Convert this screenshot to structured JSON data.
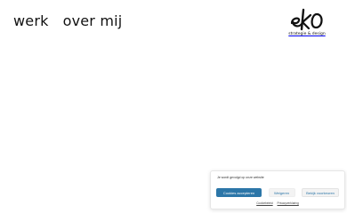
{
  "nav": {
    "items": [
      {
        "label": "werk"
      },
      {
        "label": "over mij"
      }
    ]
  },
  "logo": {
    "tagline": "strategie & design"
  },
  "cookie_banner": {
    "message": "Je wordt gevolgd op onze website",
    "buttons": {
      "accept": "Cookies accepteren",
      "deny": "Weigeren",
      "preferences": "Bekijk voorkeuren"
    },
    "links": {
      "cookie_policy": "Cookiebeleid",
      "privacy": "Privacyverklaring"
    },
    "colors": {
      "accent": "#2c76a8",
      "secondary_bg": "#f3f3f3"
    }
  }
}
